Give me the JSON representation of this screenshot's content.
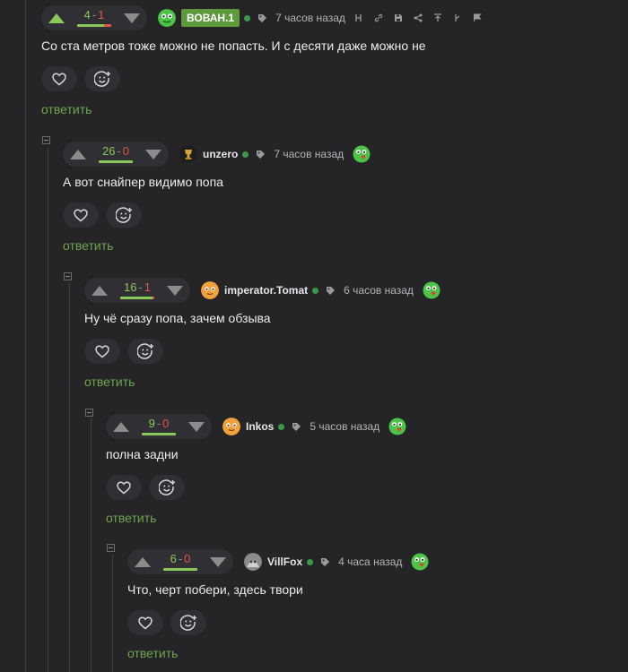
{
  "colors": {
    "background": "#252528",
    "positive": "#8ac858",
    "negative": "#e0584a",
    "reply": "#6da64d",
    "online": "#3c9a4a"
  },
  "comments": [
    {
      "plus": "4",
      "sep": "-",
      "minus": "1",
      "ratio": 0.8,
      "up_active": true,
      "author": "ВОВАН.1",
      "author_badge": true,
      "time": "7 часов назад",
      "has_tools": true,
      "has_reaction": false,
      "text": "Со ста метров тоже можно не попасть. И с десяти даже можно не",
      "reply": "ответить"
    },
    {
      "plus": "26",
      "sep": "-",
      "minus": "0",
      "ratio": 1.0,
      "up_active": false,
      "author": "unzero",
      "author_badge": false,
      "time": "7 часов назад",
      "has_tools": false,
      "has_reaction": true,
      "text": "А вот снайпер видимо попа",
      "reply": "ответить"
    },
    {
      "plus": "16",
      "sep": "-",
      "minus": "1",
      "ratio": 0.94,
      "up_active": false,
      "author": "imperator.Tomat",
      "author_badge": false,
      "time": "6 часов назад",
      "has_tools": false,
      "has_reaction": true,
      "text": "Ну чё сразу попа, зачем обзыва",
      "reply": "ответить"
    },
    {
      "plus": "9",
      "sep": "-",
      "minus": "0",
      "ratio": 1.0,
      "up_active": false,
      "author": "Inkos",
      "author_badge": false,
      "time": "5 часов назад",
      "has_tools": false,
      "has_reaction": true,
      "text": "полна задни",
      "reply": "ответить"
    },
    {
      "plus": "6",
      "sep": "-",
      "minus": "0",
      "ratio": 1.0,
      "up_active": false,
      "author": "VillFox",
      "author_badge": false,
      "time": "4 часа назад",
      "has_tools": false,
      "has_reaction": true,
      "text": "Что, черт побери, здесь твори",
      "reply": "ответить"
    }
  ]
}
